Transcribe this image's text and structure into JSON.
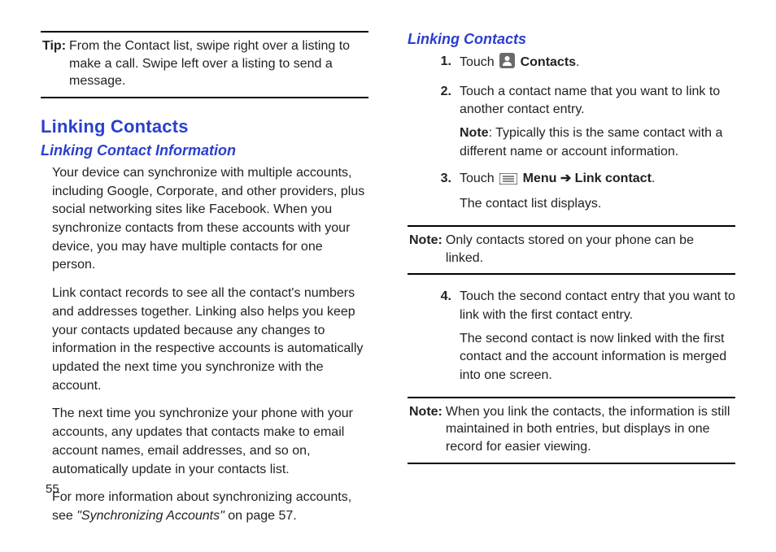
{
  "pageNumber": "55",
  "left": {
    "tip": {
      "label": "Tip:",
      "text": "From the Contact list, swipe right over a listing to make a call. Swipe left over a listing to send a message."
    },
    "headingMain": "Linking Contacts",
    "headingSub": "Linking Contact Information",
    "p1": "Your device can synchronize with multiple accounts, including Google, Corporate, and other providers, plus social networking sites like Facebook. When you synchronize contacts from these accounts with your device, you may have multiple contacts for one person.",
    "p2": "Link contact records to see all the contact's numbers and addresses together. Linking also helps you keep your contacts updated because any changes to information in the respective accounts is automatically updated the next time you synchronize with the account.",
    "p3": "The next time you synchronize your phone with your accounts, any updates that contacts make to email account names, email addresses, and so on, automatically update in your contacts list.",
    "p4_a": "For more information about synchronizing accounts, see ",
    "p4_ref": "\"Synchronizing Accounts\"",
    "p4_b": " on page 57."
  },
  "right": {
    "headingSub": "Linking Contacts",
    "steps": {
      "s1": {
        "num": "1.",
        "touch": "Touch ",
        "contactsLabel": "Contacts",
        "period": "."
      },
      "s2": {
        "num": "2.",
        "line1": "Touch a contact name that you want to link to another contact entry.",
        "noteLabel": "Note",
        "noteText": ": Typically this is the same contact with a different name or account information."
      },
      "s3": {
        "num": "3.",
        "touch": "Touch ",
        "menuLabel": "Menu",
        "arrow": " ➔ ",
        "linkLabel": "Link contact",
        "period": ".",
        "line2": "The contact list displays."
      },
      "s4": {
        "num": "4.",
        "line1": "Touch the second contact entry that you want to link with the first contact entry.",
        "line2": "The second contact is now linked with the first contact and the account information is merged into one screen."
      }
    },
    "note1": {
      "label": "Note:",
      "text": "Only contacts stored on your phone can be linked."
    },
    "note2": {
      "label": "Note:",
      "text": "When you link the contacts, the information is still maintained in both entries, but displays in one record for easier viewing."
    }
  }
}
